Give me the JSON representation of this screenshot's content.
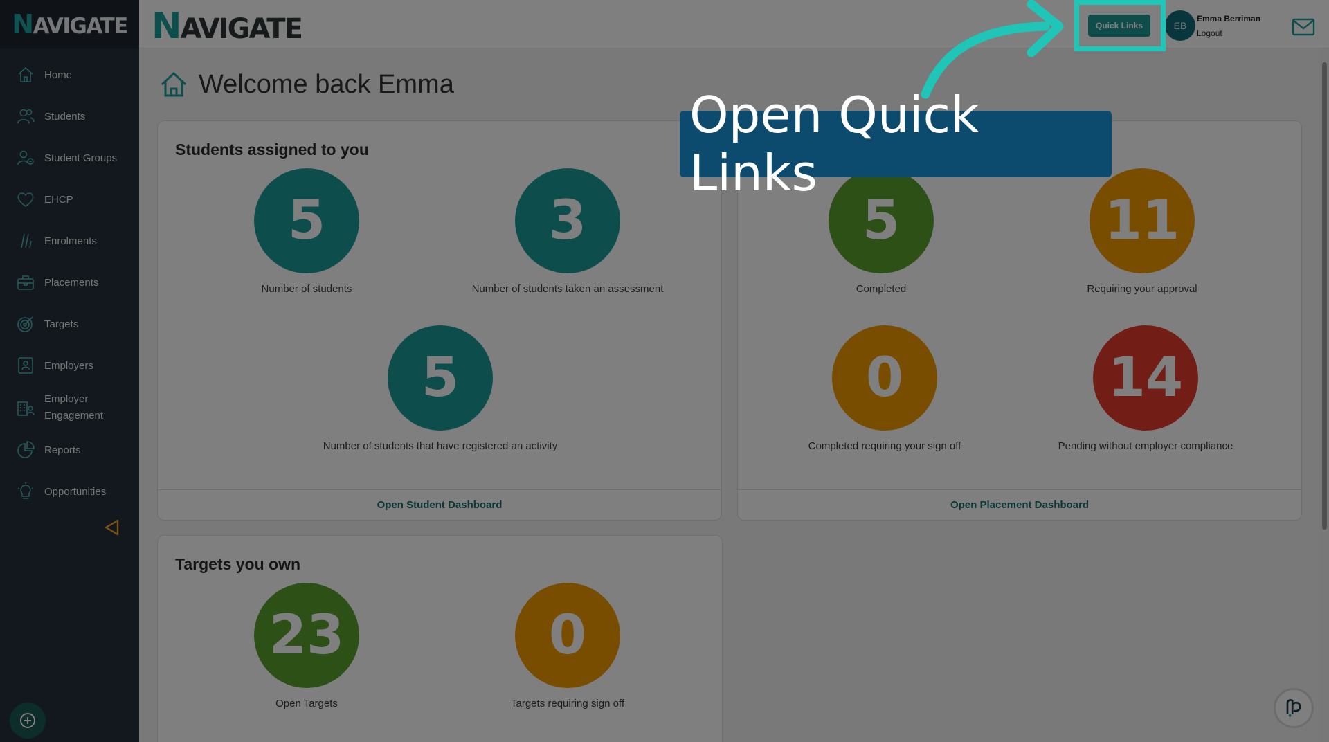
{
  "app": {
    "logo_text": "AVIGATE",
    "logo_initial": "N"
  },
  "sidebar": {
    "items": [
      {
        "label": "Home",
        "icon": "home-icon"
      },
      {
        "label": "Students",
        "icon": "students-icon"
      },
      {
        "label": "Student Groups",
        "icon": "student-groups-icon"
      },
      {
        "label": "EHCP",
        "icon": "heart-icon"
      },
      {
        "label": "Enrolments",
        "icon": "enrolments-icon"
      },
      {
        "label": "Placements",
        "icon": "briefcase-icon"
      },
      {
        "label": "Targets",
        "icon": "target-icon"
      },
      {
        "label": "Employers",
        "icon": "employer-badge-icon"
      },
      {
        "label": "Employer Engagement",
        "icon": "building-icon"
      },
      {
        "label": "Reports",
        "icon": "pie-chart-icon"
      },
      {
        "label": "Opportunities",
        "icon": "lightbulb-icon"
      }
    ]
  },
  "header": {
    "quick_links_label": "Quick Links",
    "avatar_initials": "EB",
    "user_name": "Emma Berriman",
    "logout_label": "Logout"
  },
  "main": {
    "welcome": "Welcome back Emma",
    "students_card": {
      "title": "Students assigned to you",
      "stats": [
        {
          "value": "5",
          "label": "Number of students",
          "color": "#1b9d9b"
        },
        {
          "value": "3",
          "label": "Number of students taken an assessment",
          "color": "#1b9d9b"
        },
        {
          "value": "5",
          "label": "Number of students that have registered an activity",
          "color": "#1b9d9b"
        }
      ],
      "footer": "Open Student Dashboard"
    },
    "placements_card": {
      "stats": [
        {
          "value": "5",
          "label": "Completed",
          "color": "#5aa12e"
        },
        {
          "value": "11",
          "label": "Requiring your approval",
          "color": "#f19b00"
        },
        {
          "value": "0",
          "label": "Completed requiring your sign off",
          "color": "#f19b00"
        },
        {
          "value": "14",
          "label": "Pending without employer compliance",
          "color": "#e53b2c"
        }
      ],
      "footer": "Open Placement Dashboard"
    },
    "targets_card": {
      "title": "Targets you own",
      "stats": [
        {
          "value": "23",
          "label": "Open Targets",
          "color": "#5aa12e"
        },
        {
          "value": "0",
          "label": "Targets requiring sign off",
          "color": "#f19b00"
        }
      ]
    }
  },
  "overlay": {
    "callout": "Open Quick Links"
  }
}
